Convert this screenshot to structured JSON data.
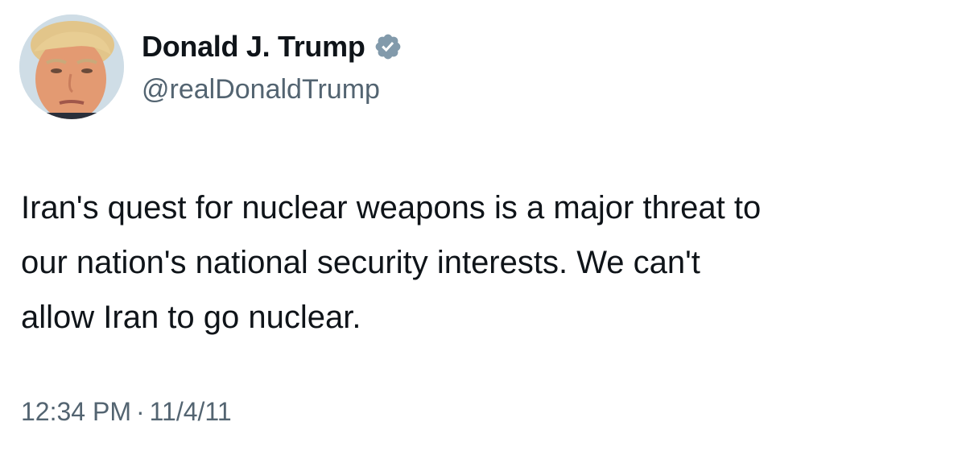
{
  "tweet": {
    "display_name": "Donald J. Trump",
    "handle": "@realDonaldTrump",
    "verified": true,
    "text": "Iran's quest for nuclear weapons is a major threat to\nour nation's national security interests. We can't\nallow Iran to go nuclear.",
    "time": "12:34 PM",
    "separator": "·",
    "date": "11/4/11"
  },
  "icons": {
    "verified": "verified-badge-icon"
  },
  "colors": {
    "text_primary": "#0f1419",
    "text_secondary": "#536471",
    "badge": "#829aab",
    "background": "#ffffff"
  }
}
